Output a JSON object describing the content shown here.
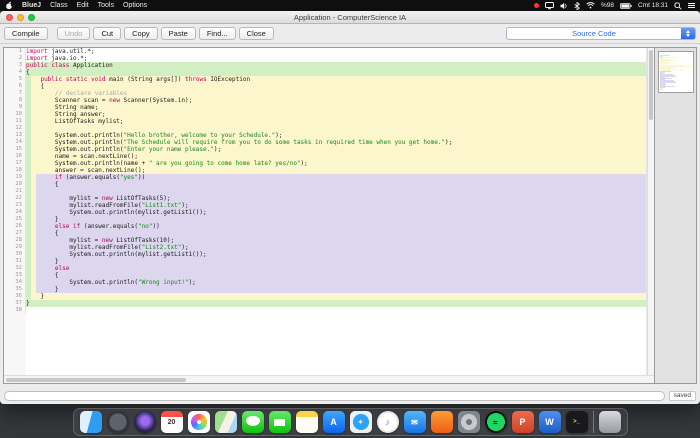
{
  "menubar": {
    "items": [
      "BlueJ",
      "Class",
      "Edit",
      "Tools",
      "Options"
    ],
    "status": {
      "battery": "%98",
      "clock": "Cmt 18:31"
    }
  },
  "window": {
    "title": "Application - ComputerScience IA",
    "toolbar": {
      "compile": "Compile",
      "buttons": [
        "Undo",
        "Cut",
        "Copy",
        "Paste",
        "Find...",
        "Close"
      ],
      "view_selector": "Source Code"
    },
    "statusbar": {
      "saved": "saved"
    }
  },
  "editor": {
    "colors": {
      "keyword": "#c0035f",
      "string": "#18871b",
      "comment": "#a9a9a9",
      "plain": "#1b1b1b",
      "scope_class": "#d2eec3",
      "scope_method": "#fcf6cd",
      "scope_block": "#dcd7ee",
      "accent": "#2f6bf0",
      "gutter_text": "#9a9a9a"
    },
    "lines": [
      {
        "n": 1,
        "s": "n",
        "t": [
          [
            "k",
            "import"
          ],
          [
            "p",
            " java.util.*;"
          ]
        ]
      },
      {
        "n": 2,
        "s": "n",
        "t": [
          [
            "k",
            "import"
          ],
          [
            "p",
            " java.io.*;"
          ]
        ]
      },
      {
        "n": 3,
        "s": "c",
        "t": [
          [
            "k",
            "public"
          ],
          [
            "p",
            " "
          ],
          [
            "k",
            "class"
          ],
          [
            "p",
            " Application"
          ]
        ]
      },
      {
        "n": 4,
        "s": "c",
        "t": [
          [
            "p",
            "{"
          ]
        ]
      },
      {
        "n": 5,
        "s": "m",
        "t": [
          [
            "p",
            "    "
          ],
          [
            "k",
            "public"
          ],
          [
            "p",
            " "
          ],
          [
            "k",
            "static"
          ],
          [
            "p",
            " "
          ],
          [
            "k",
            "void"
          ],
          [
            "p",
            " main (String args[]) "
          ],
          [
            "k",
            "throws"
          ],
          [
            "p",
            " IOException"
          ]
        ]
      },
      {
        "n": 6,
        "s": "m",
        "t": [
          [
            "p",
            "    {"
          ]
        ]
      },
      {
        "n": 7,
        "s": "m",
        "t": [
          [
            "p",
            "        "
          ],
          [
            "c",
            "// declare variables"
          ]
        ]
      },
      {
        "n": 8,
        "s": "m",
        "t": [
          [
            "p",
            "        Scanner scan = "
          ],
          [
            "k",
            "new"
          ],
          [
            "p",
            " Scanner(System.in);"
          ]
        ]
      },
      {
        "n": 9,
        "s": "m",
        "t": [
          [
            "p",
            "        String name;"
          ]
        ]
      },
      {
        "n": 10,
        "s": "m",
        "t": [
          [
            "p",
            "        String answer;"
          ]
        ]
      },
      {
        "n": 11,
        "s": "m",
        "t": [
          [
            "p",
            "        ListOfTasks mylist;"
          ]
        ]
      },
      {
        "n": 12,
        "s": "m",
        "t": []
      },
      {
        "n": 13,
        "s": "m",
        "t": [
          [
            "p",
            "        System.out.println("
          ],
          [
            "s",
            "\"Hello brother, welcome to your Schedule.\""
          ],
          [
            "p",
            ");"
          ]
        ]
      },
      {
        "n": 14,
        "s": "m",
        "t": [
          [
            "p",
            "        System.out.println("
          ],
          [
            "s",
            "\"The Schedule will require from you to do some tasks in required time when you get home.\""
          ],
          [
            "p",
            ");"
          ]
        ]
      },
      {
        "n": 15,
        "s": "m",
        "t": [
          [
            "p",
            "        System.out.println("
          ],
          [
            "s",
            "\"Enter your name please.\""
          ],
          [
            "p",
            ");"
          ]
        ]
      },
      {
        "n": 16,
        "s": "m",
        "t": [
          [
            "p",
            "        name = scan.nextLine();"
          ]
        ]
      },
      {
        "n": 17,
        "s": "m",
        "t": [
          [
            "p",
            "        System.out.println(name + "
          ],
          [
            "s",
            "\" are you going to come home late? yes/no\""
          ],
          [
            "p",
            ");"
          ]
        ]
      },
      {
        "n": 18,
        "s": "m",
        "t": [
          [
            "p",
            "        answer = scan.nextLine();"
          ]
        ]
      },
      {
        "n": 19,
        "s": "i",
        "t": [
          [
            "p",
            "        "
          ],
          [
            "k",
            "if"
          ],
          [
            "p",
            " (answer.equals("
          ],
          [
            "s",
            "\"yes\""
          ],
          [
            "p",
            "))"
          ]
        ]
      },
      {
        "n": 20,
        "s": "i",
        "t": [
          [
            "p",
            "        {"
          ]
        ]
      },
      {
        "n": 21,
        "s": "i",
        "t": []
      },
      {
        "n": 22,
        "s": "i",
        "t": [
          [
            "p",
            "            mylist = "
          ],
          [
            "k",
            "new"
          ],
          [
            "p",
            " ListOfTasks(5);"
          ]
        ]
      },
      {
        "n": 23,
        "s": "i",
        "t": [
          [
            "p",
            "            mylist.readFromFile("
          ],
          [
            "s",
            "\"List1.txt\""
          ],
          [
            "p",
            ");"
          ]
        ]
      },
      {
        "n": 24,
        "s": "i",
        "t": [
          [
            "p",
            "            System.out.println(mylist.getList1());"
          ]
        ]
      },
      {
        "n": 25,
        "s": "i",
        "t": [
          [
            "p",
            "        }"
          ]
        ]
      },
      {
        "n": 26,
        "s": "i",
        "t": [
          [
            "p",
            "        "
          ],
          [
            "k",
            "else"
          ],
          [
            "p",
            " "
          ],
          [
            "k",
            "if"
          ],
          [
            "p",
            " (answer.equals("
          ],
          [
            "s",
            "\"no\""
          ],
          [
            "p",
            "))"
          ]
        ]
      },
      {
        "n": 27,
        "s": "i",
        "t": [
          [
            "p",
            "        {"
          ]
        ]
      },
      {
        "n": 28,
        "s": "i",
        "t": [
          [
            "p",
            "            mylist = "
          ],
          [
            "k",
            "new"
          ],
          [
            "p",
            " ListOfTasks(10);"
          ]
        ]
      },
      {
        "n": 29,
        "s": "i",
        "t": [
          [
            "p",
            "            mylist.readFromFile("
          ],
          [
            "s",
            "\"List2.txt\""
          ],
          [
            "p",
            ");"
          ]
        ]
      },
      {
        "n": 30,
        "s": "i",
        "t": [
          [
            "p",
            "            System.out.println(mylist.getList1());"
          ]
        ]
      },
      {
        "n": 31,
        "s": "i",
        "t": [
          [
            "p",
            "        }"
          ]
        ]
      },
      {
        "n": 32,
        "s": "i",
        "t": [
          [
            "p",
            "        "
          ],
          [
            "k",
            "else"
          ]
        ]
      },
      {
        "n": 33,
        "s": "i",
        "t": [
          [
            "p",
            "        {"
          ]
        ]
      },
      {
        "n": 34,
        "s": "i",
        "t": [
          [
            "p",
            "            System.out.println("
          ],
          [
            "s",
            "\"Wrong input!\""
          ],
          [
            "p",
            ");"
          ]
        ]
      },
      {
        "n": 35,
        "s": "i",
        "t": [
          [
            "p",
            "        }"
          ]
        ]
      },
      {
        "n": 36,
        "s": "m",
        "t": [
          [
            "p",
            "    }"
          ]
        ]
      },
      {
        "n": 37,
        "s": "c",
        "t": [
          [
            "p",
            "}"
          ]
        ]
      },
      {
        "n": 38,
        "s": "n",
        "t": []
      }
    ]
  },
  "dock": {
    "items": [
      {
        "name": "finder",
        "bg": "linear-gradient(105deg,#dff0fb 0 45%,#2f9df2 45%)",
        "glyph": "",
        "fg": "#1a6fd4",
        "fs": 8
      },
      {
        "name": "launchpad",
        "bg": "radial-gradient(circle,#5d636b 55%,#30343a 56%)",
        "glyph": "",
        "fg": "#fff",
        "fs": 7,
        "round": true
      },
      {
        "name": "siri",
        "bg": "radial-gradient(circle at 50% 45%,#9a6df0 0 4px,#2a2250 10px)",
        "glyph": "",
        "fg": "#fff",
        "fs": 7,
        "round": true
      },
      {
        "name": "calendar",
        "bg": "linear-gradient(180deg,#ff5148 0 6px,#ffffff 6px)",
        "glyph": "20",
        "fg": "#333333",
        "fs": 7
      },
      {
        "name": "photos",
        "bg": "radial-gradient(circle,#ffffff 0 2px,rgba(255,255,255,0) 2px),radial-gradient(circle,rgba(255,255,255,0) 0 8px,#ffffff 8px),conic-gradient(#ff5f57,#ffbd2e,#8ae24e,#3ac8f5,#5a6af8,#d45af0,#ff5f57)",
        "glyph": "",
        "fg": "#fff",
        "fs": 7
      },
      {
        "name": "maps",
        "bg": "linear-gradient(115deg,#9fe08c 0 40%,#f6f1e6 40% 70%,#a8d8f0 70%)",
        "glyph": "",
        "fg": "#fff",
        "fs": 7
      },
      {
        "name": "messages",
        "bg": "radial-gradient(ellipse 7px 5px at 50% 45%,#ffffff 99%,rgba(255,255,255,0) 100%),linear-gradient(180deg,#67e86a,#0fc30f)",
        "glyph": "",
        "fg": "#fff",
        "fs": 7
      },
      {
        "name": "facetime",
        "bg": "linear-gradient(#ffffff,#ffffff) 50% 50%/11px 7px no-repeat,linear-gradient(180deg,#67e86a,#0fc30f)",
        "glyph": "",
        "fg": "#fff",
        "fs": 7
      },
      {
        "name": "notes",
        "bg": "linear-gradient(180deg,#f8d648 0 6px,#fffdf0 6px)",
        "glyph": "",
        "fg": "#888",
        "fs": 7
      },
      {
        "name": "app-store",
        "bg": "linear-gradient(180deg,#3fa6fb,#0c66ee)",
        "glyph": "A",
        "fg": "#ffffff",
        "fs": 9
      },
      {
        "name": "safari",
        "bg": "radial-gradient(circle,#2fa3f5 0 8px,#eef2f5 8px)",
        "glyph": "✦",
        "fg": "#ffffff",
        "fs": 6
      },
      {
        "name": "itunes",
        "bg": "radial-gradient(circle,#ffffff 0 9px,#e9e9e9 9px)",
        "glyph": "♪",
        "fg": "#c44af0",
        "fs": 9,
        "round": true
      },
      {
        "name": "mail",
        "bg": "linear-gradient(180deg,#55b5f8,#1773e6)",
        "glyph": "✉",
        "fg": "#ffffff",
        "fs": 8
      },
      {
        "name": "books",
        "bg": "linear-gradient(180deg,#ff9c38,#ef5e12)",
        "glyph": "",
        "fg": "#fff",
        "fs": 7
      },
      {
        "name": "system-preferences",
        "bg": "radial-gradient(circle,#70757c 0 3px,#c6cacf 3px 8px,#82878e 8px)",
        "glyph": "",
        "fg": "#555",
        "fs": 7
      },
      {
        "name": "spotify",
        "bg": "radial-gradient(circle,#1ed760 0 9px,#101010 9px)",
        "glyph": "≈",
        "fg": "#101010",
        "fs": 8,
        "round": true
      },
      {
        "name": "powerpoint",
        "bg": "linear-gradient(180deg,#ee6a4d,#cf4426)",
        "glyph": "P",
        "fg": "#ffffff",
        "fs": 9
      },
      {
        "name": "word",
        "bg": "linear-gradient(180deg,#4f8df5,#1b5fc4)",
        "glyph": "W",
        "fg": "#ffffff",
        "fs": 9
      },
      {
        "name": "terminal",
        "bg": "#19191c",
        "glyph": ">_",
        "fg": "#cfd2d6",
        "fs": 6
      },
      {
        "divider": true
      },
      {
        "name": "trash",
        "bg": "linear-gradient(180deg,rgba(245,245,250,0.85),rgba(190,192,200,0.7))",
        "glyph": "",
        "fg": "#666",
        "fs": 7
      }
    ]
  }
}
